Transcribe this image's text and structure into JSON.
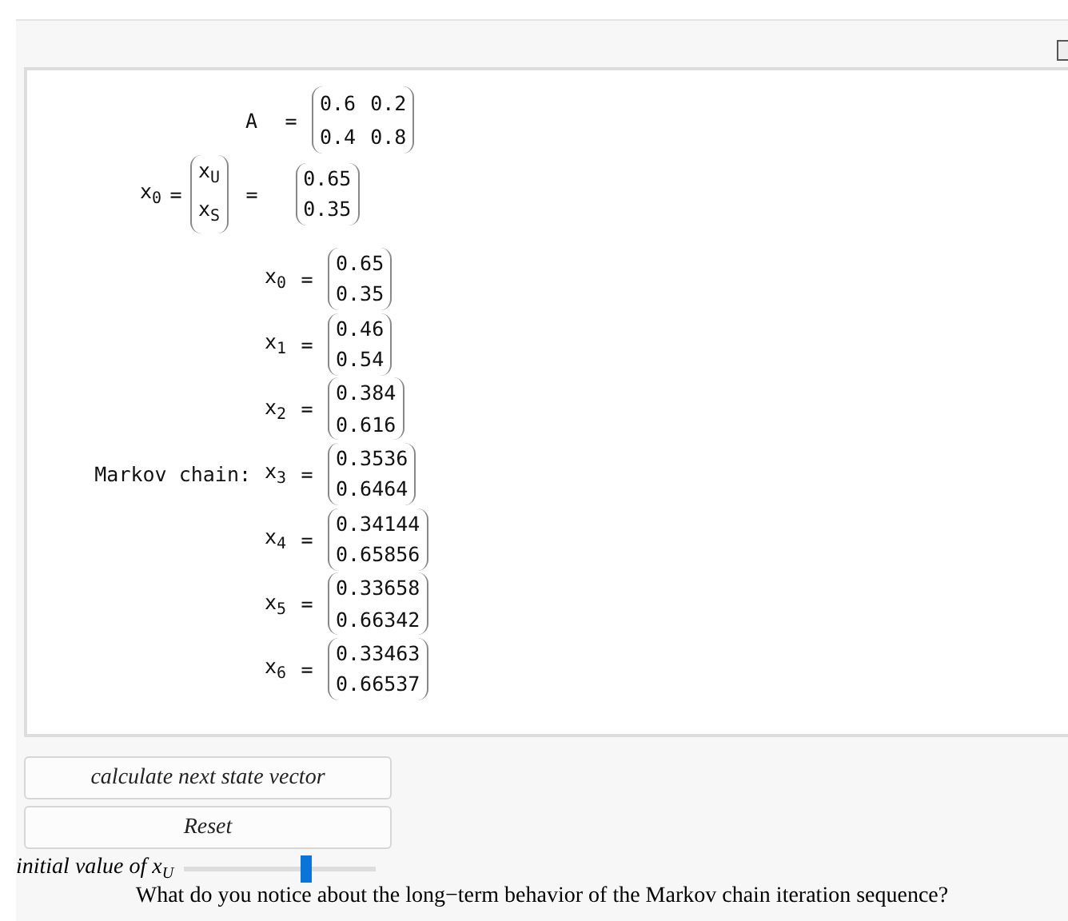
{
  "matrix_equation": {
    "lhs": "A",
    "operator": "=",
    "rows": [
      [
        "0.6",
        "0.2"
      ],
      [
        "0.4",
        "0.8"
      ]
    ]
  },
  "initial_equation": {
    "lhs": "x",
    "lhs_index": "0",
    "operators": [
      "=",
      "="
    ],
    "symbols": [
      {
        "base": "x",
        "sub": "U"
      },
      {
        "base": "x",
        "sub": "S"
      }
    ],
    "values": [
      "0.65",
      "0.35"
    ]
  },
  "markov_chain": {
    "label": "Markov chain:",
    "states": [
      {
        "name": "x",
        "index": "0",
        "operator": "=",
        "values": [
          "0.65",
          "0.35"
        ]
      },
      {
        "name": "x",
        "index": "1",
        "operator": "=",
        "values": [
          "0.46",
          "0.54"
        ]
      },
      {
        "name": "x",
        "index": "2",
        "operator": "=",
        "values": [
          "0.384",
          "0.616"
        ]
      },
      {
        "name": "x",
        "index": "3",
        "operator": "=",
        "values": [
          "0.3536",
          "0.6464"
        ]
      },
      {
        "name": "x",
        "index": "4",
        "operator": "=",
        "values": [
          "0.34144",
          "0.65856"
        ]
      },
      {
        "name": "x",
        "index": "5",
        "operator": "=",
        "values": [
          "0.33658",
          "0.66342"
        ]
      },
      {
        "name": "x",
        "index": "6",
        "operator": "=",
        "values": [
          "0.33463",
          "0.66537"
        ]
      }
    ]
  },
  "buttons": [
    "calculate next state vector",
    "Reset"
  ],
  "slider": {
    "label": "initial value of",
    "variable": "x",
    "sub": "U",
    "level": 0.64
  },
  "question": "What do you notice about the long−term behavior of the Markov chain iteration sequence?"
}
